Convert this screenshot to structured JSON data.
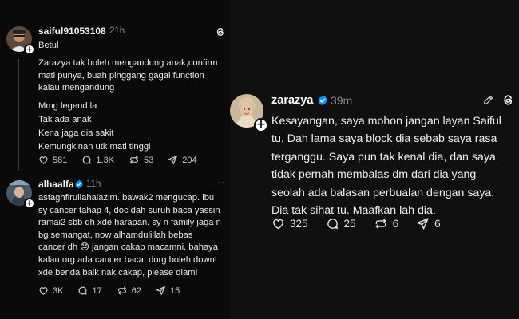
{
  "left_panel": {
    "post1": {
      "username": "saiful91053108",
      "time": "21h",
      "lines": [
        "Betul",
        "",
        "Zarazya tak boleh mengandung anak,confirm",
        "mati punya, buah pinggang gagal function",
        "kalau mengandung",
        "",
        "Mmg legend la",
        "Tak ada anak",
        "Kena jaga dia sakit",
        "Kemungkinan utk mati tinggi"
      ],
      "likes": "581",
      "comments": "1.3K",
      "reposts": "53",
      "shares": "204"
    },
    "post2": {
      "username": "alhaalfa",
      "time": "11h",
      "more": "···",
      "lines": [
        "astaghfirullahalazim. bawak2 mengucap. ibu",
        "sy cancer tahap 4, doc dah suruh baca yassin",
        "ramai2 sbb dh xde harapan, sy n family jaga n",
        "bg semangat, now alhamdulillah bebas",
        "cancer dh 😓 jangan cakap macamni. bahaya",
        "kalau org ada cancer baca, dorg boleh down!",
        "xde benda baik nak cakap, please diam!"
      ],
      "likes": "3K",
      "comments": "17",
      "reposts": "62",
      "shares": "15"
    }
  },
  "right_panel": {
    "username": "zarazya",
    "time": "39m",
    "lines": [
      "Kesayangan, saya mohon jangan layan Saiful",
      "tu. Dah lama saya block dia sebab saya rasa",
      "terganggu. Saya pun tak kenal dia, dan saya",
      "tidak pernah membalas dm dari dia yang",
      "seolah ada balasan perbualan dengan saya.",
      "Dia tak sihat tu. Maafkan lah dia."
    ],
    "likes": "325",
    "comments": "25",
    "reposts": "6",
    "shares": "6"
  },
  "colors": {
    "verified": "#0095f6",
    "muted": "#8a8a8a",
    "left_bg": "#0a0a0a",
    "right_bg": "#101010"
  },
  "icons": [
    "heart-icon",
    "comment-icon",
    "repost-icon",
    "share-icon",
    "threads-logo-icon",
    "edit-icon",
    "verified-icon",
    "follow-plus-icon"
  ]
}
